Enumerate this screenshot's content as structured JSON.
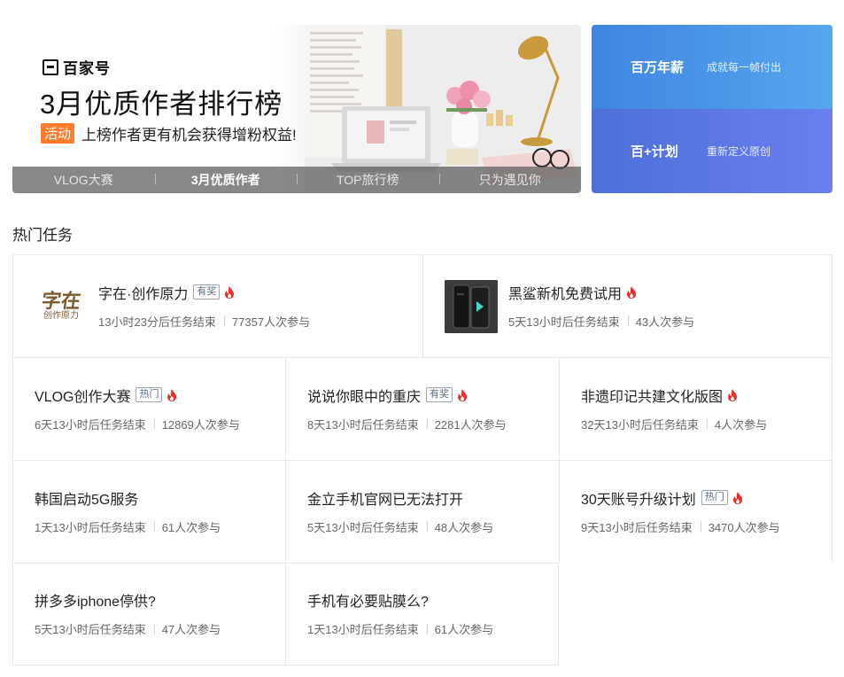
{
  "banner": {
    "logo_text": "百家号",
    "title": "3月优质作者排行榜",
    "tag": "活动",
    "subtitle": "上榜作者更有机会获得增粉权益!",
    "tabs": [
      {
        "label": "VLOG大赛",
        "active": false
      },
      {
        "label": "3月优质作者",
        "active": true
      },
      {
        "label": "TOP旅行榜",
        "active": false
      },
      {
        "label": "只为遇见你",
        "active": false
      }
    ]
  },
  "promo": [
    {
      "title": "百万年薪",
      "desc": "成就每一帧付出"
    },
    {
      "title": "百+计划",
      "desc": "重新定义原创"
    }
  ],
  "section_title": "热门任务",
  "tasks": [
    {
      "title": "字在·创作原力",
      "badge": "有奖",
      "hot": true,
      "time": "13小时23分后任务结束",
      "count": "77357人次参与",
      "thumb": "calligraphy",
      "thumb_text": "字在",
      "thumb_sub": "创作原力"
    },
    {
      "title": "黑鲨新机免费试用",
      "badge": "",
      "hot": true,
      "time": "5天13小时后任务结束",
      "count": "43人次参与",
      "thumb": "phone"
    },
    {
      "title": "VLOG创作大赛",
      "badge": "热门",
      "hot": true,
      "time": "6天13小时后任务结束",
      "count": "12869人次参与"
    },
    {
      "title": "说说你眼中的重庆",
      "badge": "有奖",
      "hot": true,
      "time": "8天13小时后任务结束",
      "count": "2281人次参与"
    },
    {
      "title": "非遗印记共建文化版图",
      "badge": "",
      "hot": true,
      "time": "32天13小时后任务结束",
      "count": "4人次参与"
    },
    {
      "title": "韩国启动5G服务",
      "badge": "",
      "hot": false,
      "time": "1天13小时后任务结束",
      "count": "61人次参与"
    },
    {
      "title": "金立手机官网已无法打开",
      "badge": "",
      "hot": false,
      "time": "5天13小时后任务结束",
      "count": "48人次参与"
    },
    {
      "title": "30天账号升级计划",
      "badge": "热门",
      "hot": true,
      "time": "9天13小时后任务结束",
      "count": "3470人次参与"
    },
    {
      "title": "拼多多iphone停供?",
      "badge": "",
      "hot": false,
      "time": "5天13小时后任务结束",
      "count": "47人次参与"
    },
    {
      "title": "手机有必要贴膜么?",
      "badge": "",
      "hot": false,
      "time": "1天13小时后任务结束",
      "count": "61人次参与"
    }
  ],
  "colors": {
    "accent_orange": "#ff7c2b",
    "flame_red": "#e5322d",
    "promo_blue_top": "#4a96e8",
    "promo_blue_bottom": "#5b78e4"
  }
}
